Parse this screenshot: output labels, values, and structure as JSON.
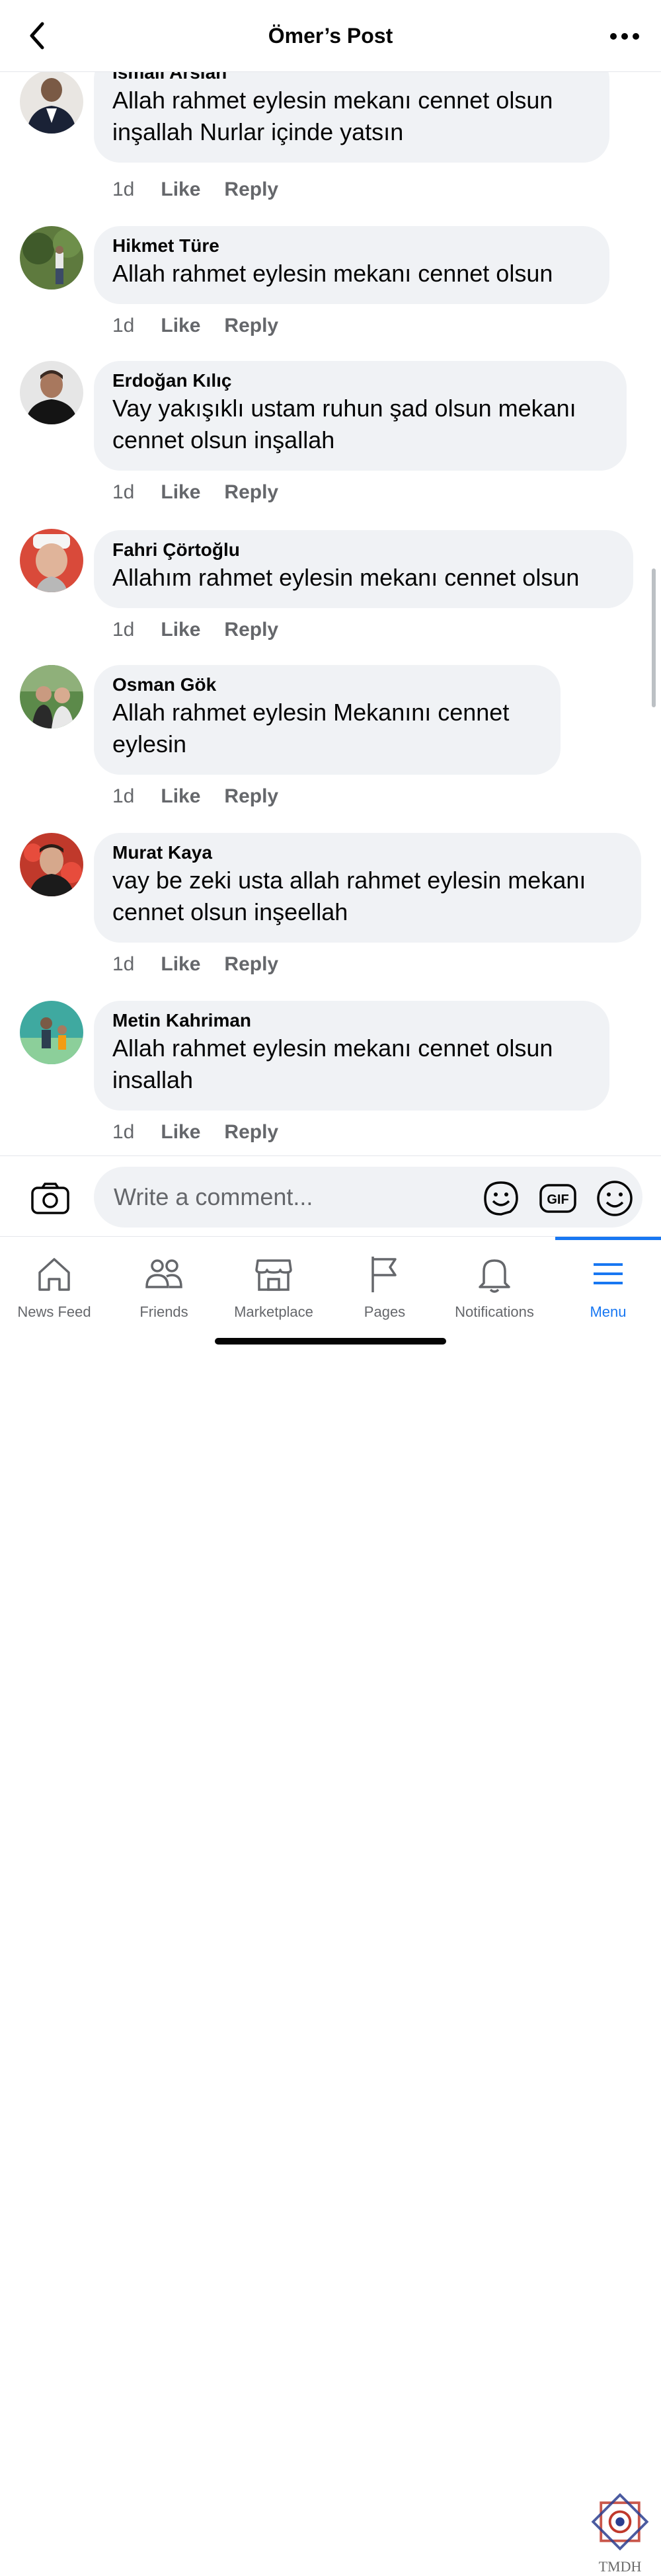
{
  "header": {
    "title": "Ömer’s Post"
  },
  "comments": [
    {
      "name": "İsmail Arslan",
      "lines": [
        "Allah rahmet eylesin mekanı cennet olsun",
        "inşallah Nurlar içinde yatsın"
      ],
      "time": "1d",
      "like": "Like",
      "reply": "Reply"
    },
    {
      "name": "Hikmet Türe",
      "lines": [
        "Allah rahmet eylesin mekanı cennet olsun"
      ],
      "time": "1d",
      "like": "Like",
      "reply": "Reply"
    },
    {
      "name": "Erdoğan Kılıç",
      "lines": [
        "Vay yakışıklı ustam ruhun şad olsun mekanı",
        "cennet olsun inşallah"
      ],
      "time": "1d",
      "like": "Like",
      "reply": "Reply"
    },
    {
      "name": "Fahri Çörtoğlu",
      "lines": [
        "Allahım rahmet eylesin mekanı cennet olsun"
      ],
      "time": "1d",
      "like": "Like",
      "reply": "Reply"
    },
    {
      "name": "Osman Gök",
      "lines": [
        "Allah rahmet eylesin Mekanını cennet",
        "eylesin"
      ],
      "time": "1d",
      "like": "Like",
      "reply": "Reply"
    },
    {
      "name": "Murat Kaya",
      "lines": [
        "vay be zeki usta allah rahmet eylesin mekanı",
        "cennet olsun inşeellah"
      ],
      "time": "1d",
      "like": "Like",
      "reply": "Reply"
    },
    {
      "name": "Metin Kahriman",
      "lines": [
        "Allah rahmet eylesin mekanı cennet olsun",
        "insallah"
      ],
      "time": "1d",
      "like": "Like",
      "reply": "Reply"
    }
  ],
  "composer": {
    "placeholder": "Write a comment..."
  },
  "nav": [
    {
      "label": "News Feed",
      "icon": "home-icon"
    },
    {
      "label": "Friends",
      "icon": "friends-icon"
    },
    {
      "label": "Marketplace",
      "icon": "marketplace-icon"
    },
    {
      "label": "Pages",
      "icon": "flag-icon"
    },
    {
      "label": "Notifications",
      "icon": "bell-icon"
    },
    {
      "label": "Menu",
      "icon": "menu-icon",
      "active": true
    }
  ],
  "watermark": {
    "text": "TMDH"
  },
  "colors": {
    "accent": "#1877f2",
    "bubble": "#f0f2f5",
    "secondary_text": "#65676b"
  }
}
